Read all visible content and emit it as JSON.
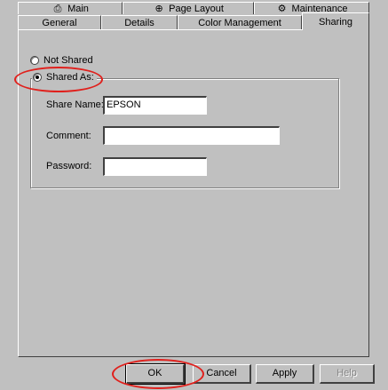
{
  "tabs_row1": [
    {
      "label": "Main",
      "icon": "printer-icon"
    },
    {
      "label": "Page Layout",
      "icon": "page-layout-icon"
    },
    {
      "label": "Maintenance",
      "icon": "maintenance-icon"
    }
  ],
  "tabs_row2": [
    {
      "label": "General"
    },
    {
      "label": "Details"
    },
    {
      "label": "Color Management"
    },
    {
      "label": "Sharing",
      "active": true
    }
  ],
  "sharing": {
    "not_shared_label": "Not Shared",
    "shared_as_label": "Shared As:",
    "selected": "shared_as",
    "share_name_label": "Share Name:",
    "share_name_value": "EPSON",
    "comment_label": "Comment:",
    "comment_value": "",
    "password_label": "Password:",
    "password_value": ""
  },
  "buttons": {
    "ok": "OK",
    "cancel": "Cancel",
    "apply": "Apply",
    "help": "Help"
  },
  "colors": {
    "dialog_face": "#c0c0c0",
    "annotation_circle": "#e0201c"
  }
}
